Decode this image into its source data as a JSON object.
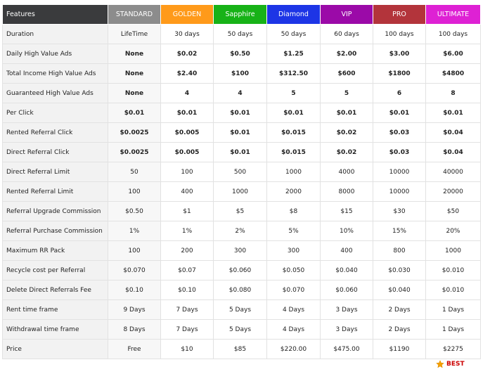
{
  "headers": [
    {
      "label": "Features",
      "color": "#3a3b3d"
    },
    {
      "label": "STANDARD",
      "color": "#8c8c8c"
    },
    {
      "label": "GOLDEN",
      "color": "#ff9a1a"
    },
    {
      "label": "Sapphire",
      "color": "#17b217"
    },
    {
      "label": "Diamond",
      "color": "#1d35e6"
    },
    {
      "label": "VIP",
      "color": "#9b0aa8"
    },
    {
      "label": "PRO",
      "color": "#b3343b"
    },
    {
      "label": "ULTIMATE",
      "color": "#de21d4"
    }
  ],
  "rows": [
    {
      "bold": false,
      "cells": [
        "Duration",
        "LifeTime",
        "30 days",
        "50 days",
        "50 days",
        "60 days",
        "100 days",
        "100 days"
      ]
    },
    {
      "bold": true,
      "cells": [
        "Daily High Value Ads",
        "None",
        "$0.02",
        "$0.50",
        "$1.25",
        "$2.00",
        "$3.00",
        "$6.00"
      ]
    },
    {
      "bold": true,
      "cells": [
        "Total Income High Value Ads",
        "None",
        "$2.40",
        "$100",
        "$312.50",
        "$600",
        "$1800",
        "$4800"
      ]
    },
    {
      "bold": true,
      "cells": [
        "Guaranteed High Value Ads",
        "None",
        "4",
        "4",
        "5",
        "5",
        "6",
        "8"
      ]
    },
    {
      "bold": true,
      "cells": [
        "Per Click",
        "$0.01",
        "$0.01",
        "$0.01",
        "$0.01",
        "$0.01",
        "$0.01",
        "$0.01"
      ]
    },
    {
      "bold": true,
      "cells": [
        "Rented Referral Click",
        "$0.0025",
        "$0.005",
        "$0.01",
        "$0.015",
        "$0.02",
        "$0.03",
        "$0.04"
      ]
    },
    {
      "bold": true,
      "cells": [
        "Direct Referral Click",
        "$0.0025",
        "$0.005",
        "$0.01",
        "$0.015",
        "$0.02",
        "$0.03",
        "$0.04"
      ]
    },
    {
      "bold": false,
      "cells": [
        "Direct Referral Limit",
        "50",
        "100",
        "500",
        "1000",
        "4000",
        "10000",
        "40000"
      ]
    },
    {
      "bold": false,
      "cells": [
        "Rented Referral Limit",
        "100",
        "400",
        "1000",
        "2000",
        "8000",
        "10000",
        "20000"
      ]
    },
    {
      "bold": false,
      "cells": [
        "Referral Upgrade Commission",
        "$0.50",
        "$1",
        "$5",
        "$8",
        "$15",
        "$30",
        "$50"
      ]
    },
    {
      "bold": false,
      "cells": [
        "Referral Purchase Commission",
        "1%",
        "1%",
        "2%",
        "5%",
        "10%",
        "15%",
        "20%"
      ]
    },
    {
      "bold": false,
      "cells": [
        "Maximum RR Pack",
        "100",
        "200",
        "300",
        "300",
        "400",
        "800",
        "1000"
      ]
    },
    {
      "bold": false,
      "cells": [
        "Recycle cost per Referral",
        "$0.070",
        "$0.07",
        "$0.060",
        "$0.050",
        "$0.040",
        "$0.030",
        "$0.010"
      ]
    },
    {
      "bold": false,
      "cells": [
        "Delete Direct Referrals Fee",
        "$0.10",
        "$0.10",
        "$0.080",
        "$0.070",
        "$0.060",
        "$0.040",
        "$0.010"
      ]
    },
    {
      "bold": false,
      "cells": [
        "Rent time frame",
        "9 Days",
        "7 Days",
        "5 Days",
        "4 Days",
        "3 Days",
        "2 Days",
        "1 Days"
      ]
    },
    {
      "bold": false,
      "cells": [
        "Withdrawal time frame",
        "8 Days",
        "7 Days",
        "5 Days",
        "4 Days",
        "3 Days",
        "2 Days",
        "1 Days"
      ]
    },
    {
      "bold": false,
      "cells": [
        "Price",
        "Free",
        "$10",
        "$85",
        "$220.00",
        "$475.00",
        "$1190",
        "$2275"
      ]
    }
  ],
  "badge": {
    "label": "BEST",
    "icon": "star-icon",
    "color": "#cc0000"
  }
}
